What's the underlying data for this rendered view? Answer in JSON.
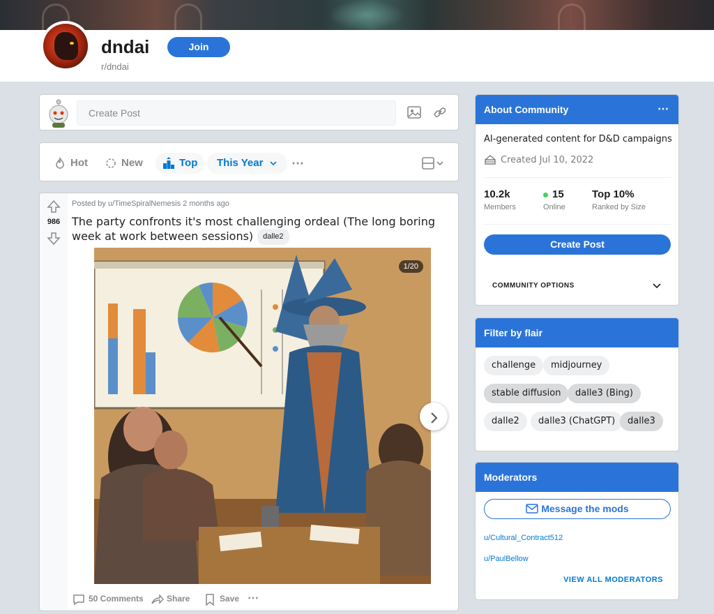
{
  "community": {
    "name": "dndai",
    "path": "r/dndai",
    "join_label": "Join"
  },
  "create_post": {
    "placeholder": "Create Post"
  },
  "sort": {
    "hot": "Hot",
    "new": "New",
    "top": "Top",
    "time_range": "This Year"
  },
  "post": {
    "votes": "986",
    "meta": "Posted by u/TimeSpiralNemesis 2 months ago",
    "title": "The party confronts it's most challenging ordeal (The long boring week at work between sessions)",
    "flair": "dalle2",
    "gallery_counter": "1/20",
    "actions": {
      "comments": "50 Comments",
      "share": "Share",
      "save": "Save"
    }
  },
  "about": {
    "heading": "About Community",
    "description": "AI-generated content for D&D campaigns",
    "created": "Created Jul 10, 2022",
    "members_value": "10.2k",
    "members_label": "Members",
    "online_value": "15",
    "online_label": "Online",
    "rank_value": "Top 10%",
    "rank_label": "Ranked by Size",
    "create_post_label": "Create Post",
    "options_label": "COMMUNITY OPTIONS"
  },
  "flair_filter": {
    "heading": "Filter by flair",
    "items": [
      "challenge",
      "midjourney",
      "stable diffusion",
      "dalle3 (Bing)",
      "dalle2",
      "dalle3 (ChatGPT)",
      "dalle3"
    ]
  },
  "moderators": {
    "heading": "Moderators",
    "message_label": "Message the mods",
    "list": [
      "u/Cultural_Contract512",
      "u/PaulBellow"
    ],
    "view_all": "VIEW ALL MODERATORS"
  },
  "colors": {
    "accent": "#2a74d9",
    "link": "#0079d3",
    "background": "#dae0e6"
  }
}
